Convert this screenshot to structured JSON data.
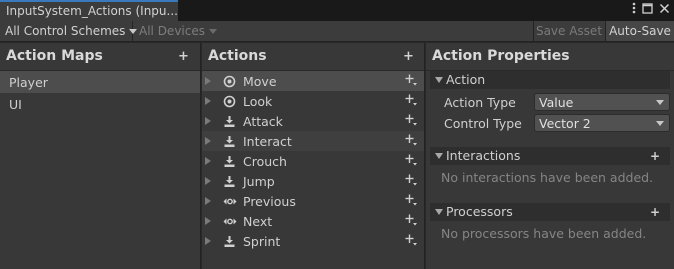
{
  "window": {
    "tab_title": "InputSystem_Actions (Inpu...",
    "menu_icon": "kebab-menu-icon",
    "maximize_icon": "maximize-icon",
    "close_icon": "close-icon"
  },
  "toolbar": {
    "control_schemes": "All Control Schemes",
    "devices": "All Devices",
    "save_asset": "Save Asset",
    "auto_save": "Auto-Save"
  },
  "action_maps": {
    "header": "Action Maps",
    "items": [
      "Player",
      "UI"
    ],
    "selected_index": 0
  },
  "actions": {
    "header": "Actions",
    "items": [
      {
        "label": "Move",
        "icon": "value-icon",
        "selected": true
      },
      {
        "label": "Look",
        "icon": "value-icon"
      },
      {
        "label": "Attack",
        "icon": "button-icon"
      },
      {
        "label": "Interact",
        "icon": "button-icon",
        "hover": true
      },
      {
        "label": "Crouch",
        "icon": "button-icon"
      },
      {
        "label": "Jump",
        "icon": "button-icon"
      },
      {
        "label": "Previous",
        "icon": "passthrough-icon"
      },
      {
        "label": "Next",
        "icon": "passthrough-icon"
      },
      {
        "label": "Sprint",
        "icon": "button-icon"
      }
    ]
  },
  "properties": {
    "header": "Action Properties",
    "action_section": "Action",
    "action_type_label": "Action Type",
    "action_type_value": "Value",
    "control_type_label": "Control Type",
    "control_type_value": "Vector 2",
    "interactions_section": "Interactions",
    "interactions_empty": "No interactions have been added.",
    "processors_section": "Processors",
    "processors_empty": "No processors have been added."
  },
  "colors": {
    "tab_accent": "#3a79bb",
    "panel_bg": "#383838",
    "selected_row": "#4d4d4d"
  }
}
